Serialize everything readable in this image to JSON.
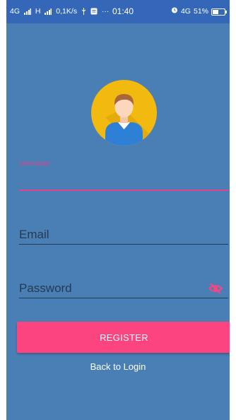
{
  "status_bar": {
    "network1": "4G",
    "network2": "H",
    "speed": "0,1K/s",
    "more": "···",
    "time": "01:40",
    "network3": "4G",
    "battery_percent": "51%",
    "battery_level": 0.51
  },
  "form": {
    "username": {
      "label": "Username",
      "value": ""
    },
    "email": {
      "placeholder": "Email",
      "value": ""
    },
    "password": {
      "placeholder": "Password",
      "value": ""
    }
  },
  "actions": {
    "register_label": "REGISTER",
    "back_label": "Back to Login"
  },
  "colors": {
    "background": "#4a7fb5",
    "status_bar": "#3467b7",
    "accent": "#fc4480",
    "avatar_circle": "#f2b90f"
  },
  "icons": {
    "avatar": "user-avatar-icon",
    "password_toggle": "eye-off-icon"
  }
}
